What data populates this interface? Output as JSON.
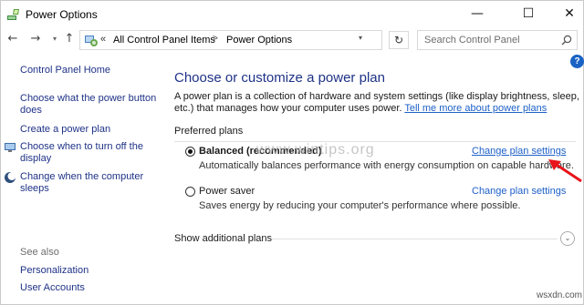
{
  "window": {
    "title": "Power Options",
    "minimize": "—",
    "maximize": "☐",
    "close": "✕"
  },
  "nav": {
    "back": "←",
    "forward": "→",
    "recent": "▾",
    "up": "↑",
    "chevron": "«",
    "breadcrumb": [
      "All Control Panel Items",
      "Power Options"
    ],
    "separator": ">",
    "dropdown": "▾",
    "refresh": "↻",
    "search_placeholder": "Search Control Panel"
  },
  "left_pane": {
    "home": "Control Panel Home",
    "links": [
      "Choose what the power button does",
      "Create a power plan",
      "Choose when to turn off the display",
      "Change when the computer sleeps"
    ],
    "see_also": "See also",
    "see_also_links": [
      "Personalization",
      "User Accounts"
    ]
  },
  "main": {
    "help": "?",
    "heading": "Choose or customize a power plan",
    "intro": "A power plan is a collection of hardware and system settings (like display brightness, sleep, etc.) that manages how your computer uses power.",
    "intro_link": "Tell me more about power plans",
    "section": "Preferred plans",
    "plans": [
      {
        "name": "Balanced (recommended)",
        "selected": true,
        "description": "Automatically balances performance with energy consumption on capable hardware.",
        "link": "Change plan settings"
      },
      {
        "name": "Power saver",
        "selected": false,
        "description": "Saves energy by reducing your computer's performance where possible.",
        "link": "Change plan settings"
      }
    ],
    "show_more": "Show additional plans",
    "expand": "⌄"
  },
  "watermark": "www.wintips.org",
  "site": "wsxdn.com",
  "colors": {
    "link": "#1e60c8",
    "nav_link": "#1e3287",
    "heading": "#1e3287",
    "arrow": "#e8141c"
  }
}
